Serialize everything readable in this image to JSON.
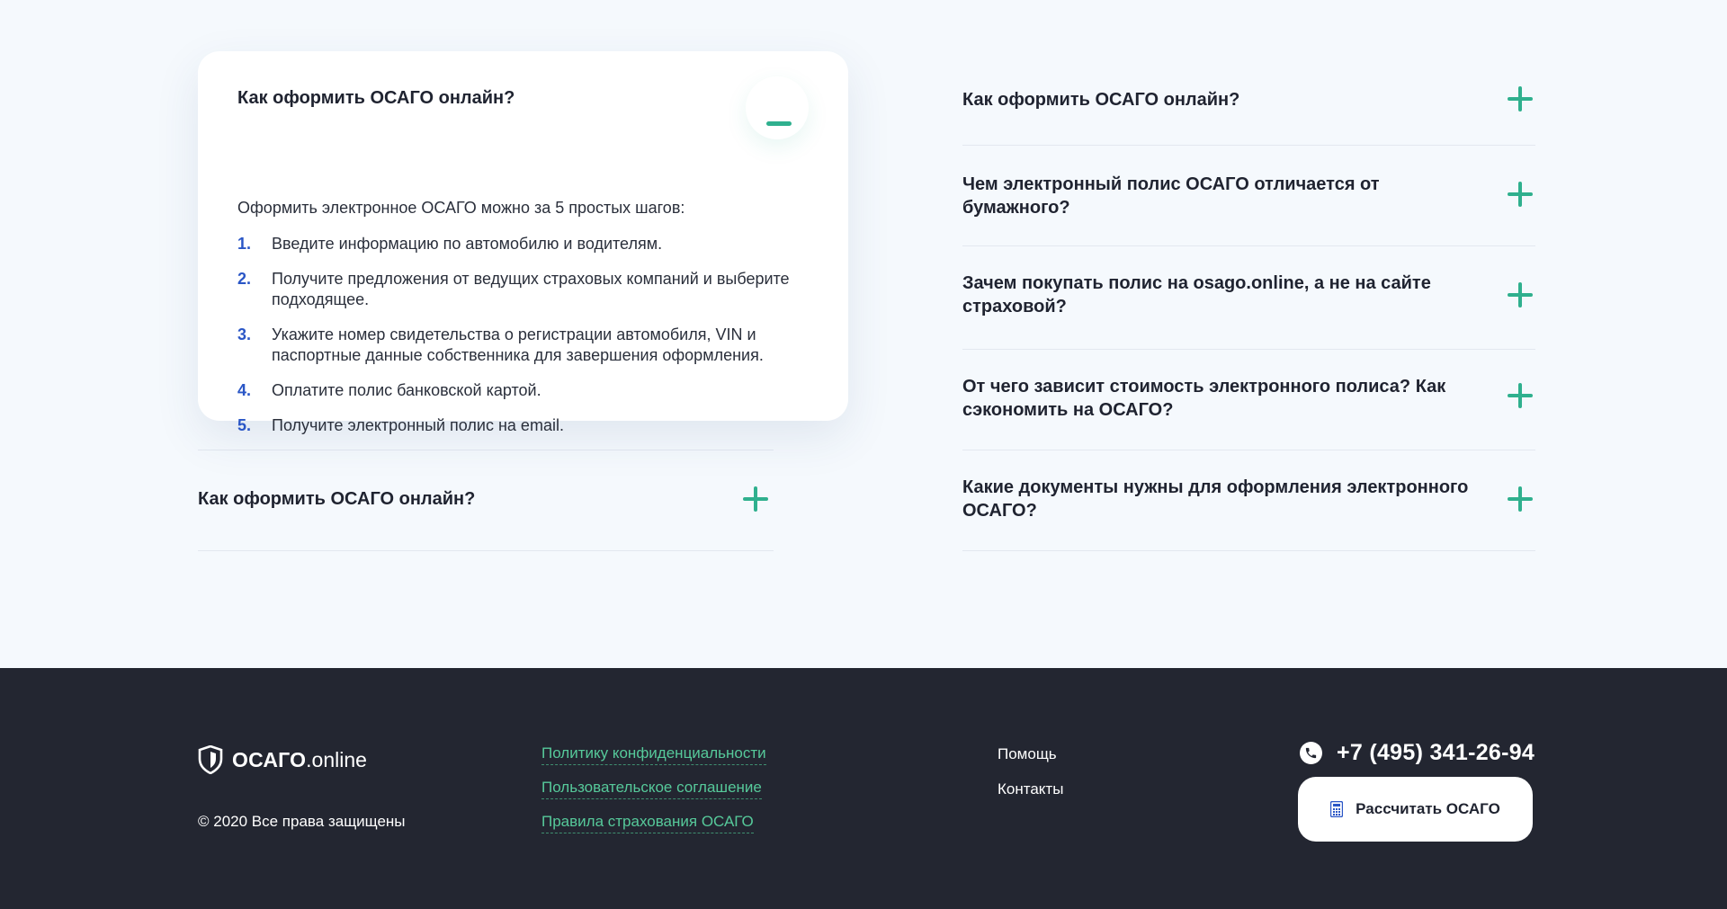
{
  "faq": {
    "open_item": {
      "title": "Как оформить ОСАГО онлайн?",
      "intro": "Оформить электронное ОСАГО можно за 5 простых шагов:",
      "steps": [
        {
          "num": "1.",
          "text": "Введите информацию по автомобилю и водителям."
        },
        {
          "num": "2.",
          "text": "Получите предложения от ведущих страховых компаний и выберите подходящее."
        },
        {
          "num": "3.",
          "text": "Укажите номер свидетельства о регистрации автомобиля, VIN и паспортные данные собственника для завершения оформления."
        },
        {
          "num": "4.",
          "text": "Оплатите полис банковской картой."
        },
        {
          "num": "5.",
          "text": "Получите электронный полис на email."
        }
      ]
    },
    "left_items": [
      {
        "title": "Как оформить ОСАГО онлайн?"
      }
    ],
    "right_items": [
      {
        "title": "Как оформить ОСАГО онлайн?"
      },
      {
        "title": "Чем электронный полис ОСАГО отличается от бумажного?"
      },
      {
        "title": "Зачем покупать полис на osago.online, а не на сайте страховой?"
      },
      {
        "title": "От чего зависит стоимость электронного полиса? Как сэкономить на ОСАГО?"
      },
      {
        "title": "Какие документы нужны для оформления электронного ОСАГО?"
      }
    ]
  },
  "footer": {
    "logo": {
      "bold": "ОСАГО",
      "thin": ".online",
      "icon": "shield-icon"
    },
    "copyright": "© 2020 Все права защищены",
    "legal_links": [
      "Политику конфиденциальности",
      "Пользовательское соглашение",
      "Правила страхования ОСАГО"
    ],
    "nav_links": [
      "Помощь",
      "Контакты"
    ],
    "phone": {
      "number": "+7 (495) 341-26-94",
      "icon": "phone-icon"
    },
    "cta": {
      "label": "Рассчитать ОСАГО",
      "icon": "calculator-icon"
    }
  },
  "colors": {
    "accent_green": "#2fb08e",
    "link_green": "#56c99a",
    "step_blue": "#2a56c6",
    "footer_bg": "#232631",
    "page_bg": "#f5f9fd"
  }
}
